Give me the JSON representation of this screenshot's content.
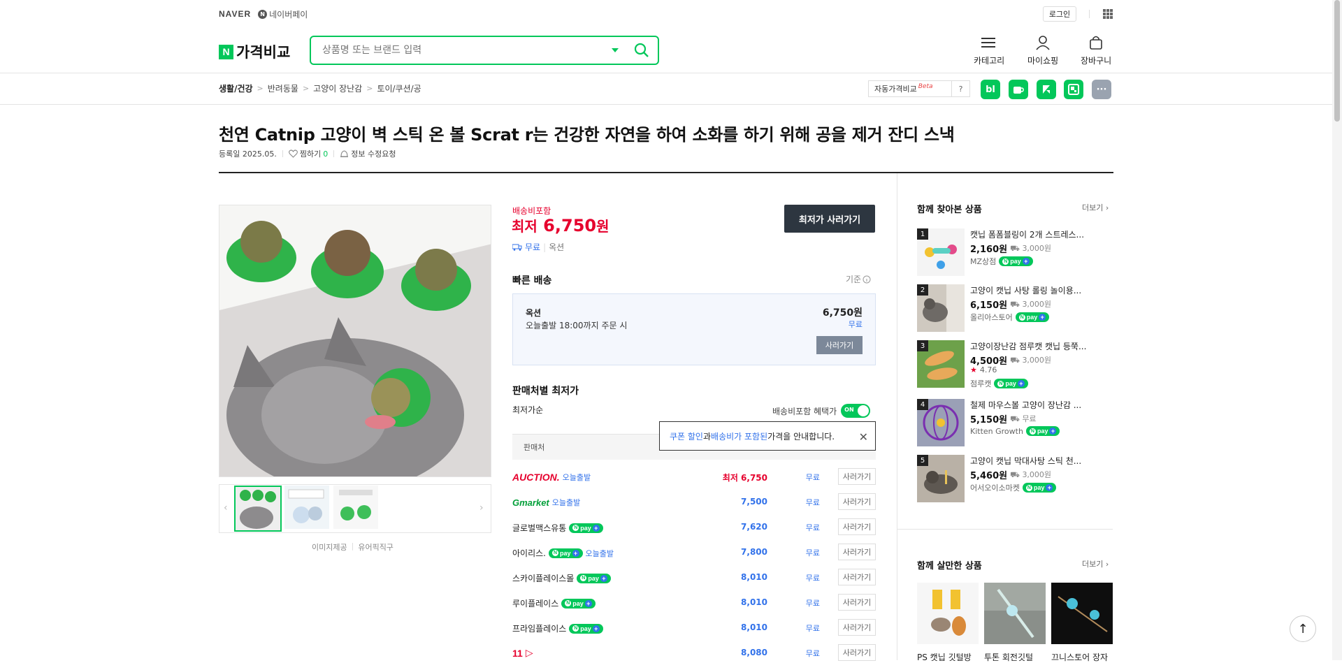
{
  "util": {
    "naver": "NAVER",
    "npay": "네이버페이",
    "login": "로그인"
  },
  "header": {
    "logo_n": "N",
    "logo_text": "가격비교",
    "search_placeholder": "상품명 또는 브랜드 입력",
    "nav": [
      {
        "label": "카테고리"
      },
      {
        "label": "마이쇼핑"
      },
      {
        "label": "장바구니"
      }
    ]
  },
  "breadcrumb": [
    "생활/건강",
    "반려동물",
    "고양이 장난감",
    "토이/쿠션/공"
  ],
  "auto_compare": {
    "label": "자동가격비교",
    "beta": "Beta",
    "help": "?"
  },
  "share": [
    "bl",
    "",
    "",
    "",
    "···"
  ],
  "product": {
    "title": "천연 Catnip 고양이 벽 스틱 온 볼 Scrat r는 건강한 자연을 하여 소화를 하기 위해 공을 제거 잔디 스낵",
    "reg_date": "등록일 2025.05.",
    "like_label": "찜하기",
    "like_count": "0",
    "report": "정보 수정요청",
    "image_credit": "이미지제공",
    "image_source": "유어픽직구"
  },
  "price": {
    "ship_included": "배송비포함",
    "lowest_label": "최저",
    "lowest_value": "6,750",
    "won": "원",
    "free": "무료",
    "seller": "옥션",
    "buy_lowest": "최저가 사러가기"
  },
  "fast": {
    "heading": "빠른 배송",
    "basis": "기준",
    "seller": "옥션",
    "desc": "오늘출발 18:00까지 주문 시",
    "price": "6,750원",
    "ship": "무료",
    "buy": "사러가기"
  },
  "sellers": {
    "heading": "판매처별 최저가",
    "sort": "최저가순",
    "benefit": "배송비포함 혜택가",
    "toggle": "ON",
    "tooltip_pre": "쿠폰 할인",
    "tooltip_mid": "과 ",
    "tooltip_ship": "배송비가 포함된",
    "tooltip_post": " 가격을 안내합니다.",
    "col_seller": "판매처",
    "rows": [
      {
        "name": "AUCTION.",
        "tag": "오늘출발",
        "price": "최저 6,750",
        "ship": "무료",
        "buy": "사러가기"
      },
      {
        "name": "Gmarket",
        "tag": "오늘출발",
        "price": "7,500",
        "ship": "무료",
        "buy": "사러가기"
      },
      {
        "name": "글로벌맥스유통",
        "tag": "",
        "price": "7,620",
        "ship": "무료",
        "buy": "사러가기"
      },
      {
        "name": "아이리스.",
        "tag": "오늘출발",
        "price": "7,800",
        "ship": "무료",
        "buy": "사러가기"
      },
      {
        "name": "스카이플레이스몰",
        "tag": "",
        "price": "8,010",
        "ship": "무료",
        "buy": "사러가기"
      },
      {
        "name": "루이플레이스",
        "tag": "",
        "price": "8,010",
        "ship": "무료",
        "buy": "사러가기"
      },
      {
        "name": "프라임플레이스",
        "tag": "",
        "price": "8,010",
        "ship": "무료",
        "buy": "사러가기"
      },
      {
        "name": "11",
        "tag": "",
        "price": "8,080",
        "ship": "무료",
        "buy": "사러가기"
      }
    ]
  },
  "pay_label": "pay",
  "viewed": {
    "heading": "함께 찾아본 상품",
    "more": "더보기",
    "items": [
      {
        "rank": "1",
        "title": "캣닙 폼폼블링이 2개 스트레스...",
        "price": "2,160원",
        "ship": "3,000원",
        "store": "MZ상점",
        "rating": ""
      },
      {
        "rank": "2",
        "title": "고양이 캣닙 사탕 롤링 놀이용...",
        "price": "6,150원",
        "ship": "3,000원",
        "store": "올리아스토어",
        "rating": ""
      },
      {
        "rank": "3",
        "title": "고양이장난감 점루캣 캣닙 등쭉...",
        "price": "4,500원",
        "ship": "3,000원",
        "store": "점루캣",
        "rating": "4.76"
      },
      {
        "rank": "4",
        "title": "철제 마우스볼 고양이 장난감 ...",
        "price": "5,150원",
        "ship": "무료",
        "store": "Kitten Growth",
        "rating": ""
      },
      {
        "rank": "5",
        "title": "고양이 캣닙 막대사탕 스틱 천...",
        "price": "5,460원",
        "ship": "3,000원",
        "store": "어서오이소마켓",
        "rating": ""
      }
    ]
  },
  "bought": {
    "heading": "함께 살만한 상품",
    "more": "더보기",
    "items": [
      {
        "title": "PS 캣닙 깃털방"
      },
      {
        "title": "투톤 회전깃털"
      },
      {
        "title": "끄니스토어 장자"
      }
    ]
  }
}
